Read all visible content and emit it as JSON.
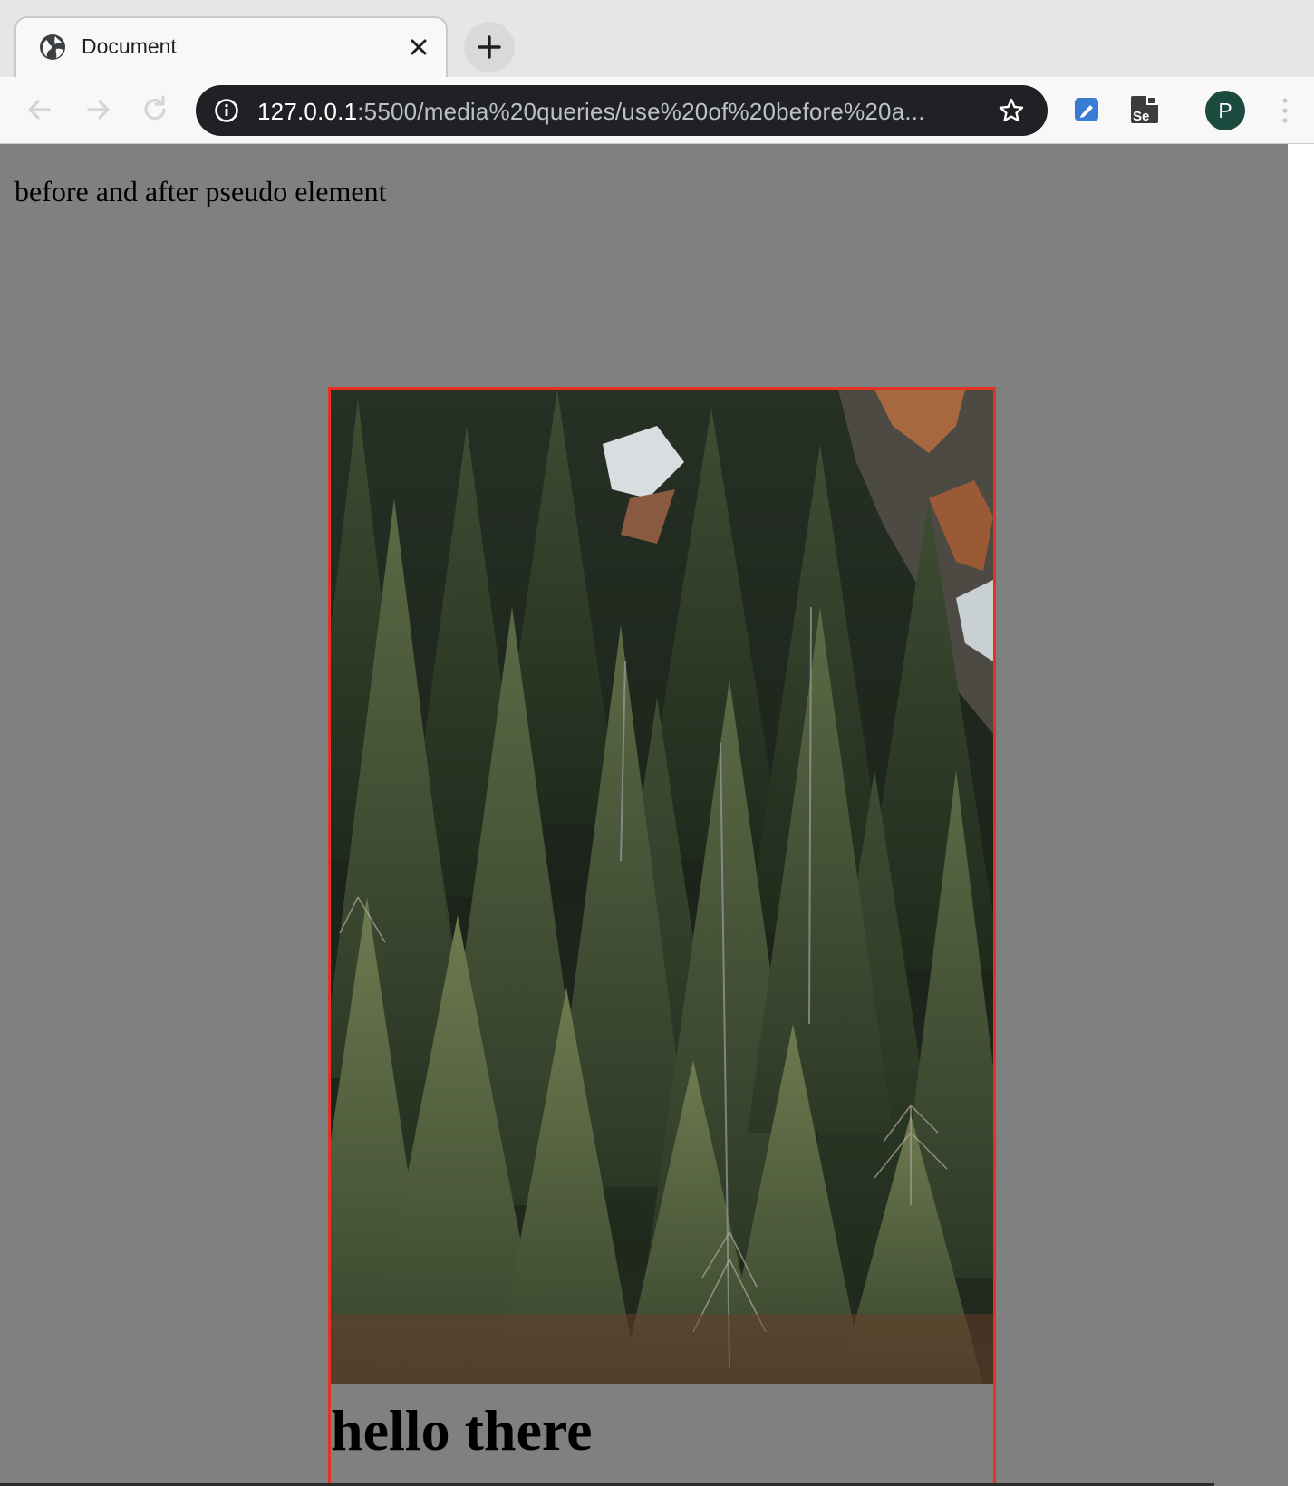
{
  "browser": {
    "tab": {
      "title": "Document",
      "favicon": "globe-icon",
      "close_icon": "close-icon"
    },
    "new_tab_icon": "plus-icon",
    "toolbar": {
      "back_icon": "arrow-left-icon",
      "forward_icon": "arrow-right-icon",
      "reload_icon": "reload-icon",
      "url_host": "127.0.0.1",
      "url_path": ":5500/media%20queries/use%20of%20before%20a...",
      "bookmark_icon": "star-icon",
      "extensions": [
        "pen-extension-icon",
        "selenium-ide-icon"
      ],
      "profile_initial": "P",
      "menu_icon": "kebab-menu-icon"
    }
  },
  "page": {
    "background_color": "#808080",
    "intro_text": "before and after pseudo element",
    "card": {
      "border_color": "#e53224",
      "image": "pine-forest-photo",
      "heading": "hello there"
    }
  }
}
